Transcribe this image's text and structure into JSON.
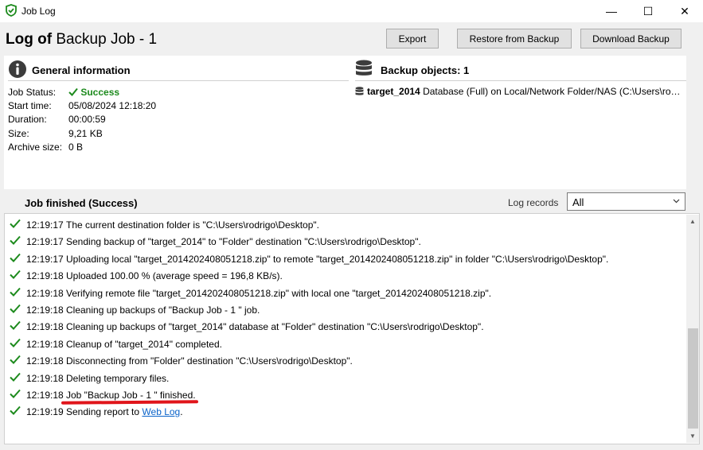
{
  "window": {
    "title": "Job Log",
    "min_glyph": "—",
    "max_glyph": "☐",
    "close_glyph": "✕"
  },
  "header": {
    "title_prefix": "Log of",
    "title_name": "Backup Job - 1",
    "export_label": "Export",
    "restore_label": "Restore from Backup",
    "download_label": "Download Backup"
  },
  "general": {
    "title": "General information",
    "rows": [
      {
        "label": "Job Status:",
        "value": "Success"
      },
      {
        "label": "Start time:",
        "value": "05/08/2024 12:18:20"
      },
      {
        "label": "Duration:",
        "value": "00:00:59"
      },
      {
        "label": "Size:",
        "value": "9,21 KB"
      },
      {
        "label": "Archive size:",
        "value": "0 B"
      }
    ]
  },
  "backup_objects": {
    "title": "Backup objects: 1",
    "items": [
      {
        "name": "target_2014",
        "detail": "Database (Full) on Local/Network Folder/NAS (C:\\Users\\rodrigo\\Desktop\\)"
      }
    ]
  },
  "log": {
    "title": "Job finished (Success)",
    "records_label": "Log records",
    "filter_value": "All",
    "entries": [
      {
        "time": "12:19:17",
        "msg": "The current destination folder is \"C:\\Users\\rodrigo\\Desktop\"."
      },
      {
        "time": "12:19:17",
        "msg": "Sending backup of \"target_2014\" to \"Folder\" destination \"C:\\Users\\rodrigo\\Desktop\"."
      },
      {
        "time": "12:19:17",
        "msg": "Uploading local \"target_2014202408051218.zip\" to remote \"target_2014202408051218.zip\" in folder \"C:\\Users\\rodrigo\\Desktop\"."
      },
      {
        "time": "12:19:18",
        "msg": "Uploaded 100.00 % (average speed = 196,8 KB/s)."
      },
      {
        "time": "12:19:18",
        "msg": "Verifying remote file \"target_2014202408051218.zip\" with local one \"target_2014202408051218.zip\"."
      },
      {
        "time": "12:19:18",
        "msg": "Cleaning up backups of \"Backup Job - 1 \" job."
      },
      {
        "time": "12:19:18",
        "msg": "Cleaning up backups of \"target_2014\" database at \"Folder\" destination \"C:\\Users\\rodrigo\\Desktop\"."
      },
      {
        "time": "12:19:18",
        "msg": "Cleanup of \"target_2014\" completed."
      },
      {
        "time": "12:19:18",
        "msg": "Disconnecting from \"Folder\" destination \"C:\\Users\\rodrigo\\Desktop\"."
      },
      {
        "time": "12:19:18",
        "msg": "Deleting temporary files."
      },
      {
        "time": "12:19:18",
        "msg": "Job \"Backup Job - 1 \" finished."
      }
    ],
    "last_entry": {
      "time": "12:19:19",
      "msg_prefix": "Sending report to ",
      "link": "Web Log",
      "msg_suffix": "."
    }
  },
  "colors": {
    "success": "#1c8a1c",
    "link": "#0a63c9",
    "annotation": "#e0151b"
  }
}
